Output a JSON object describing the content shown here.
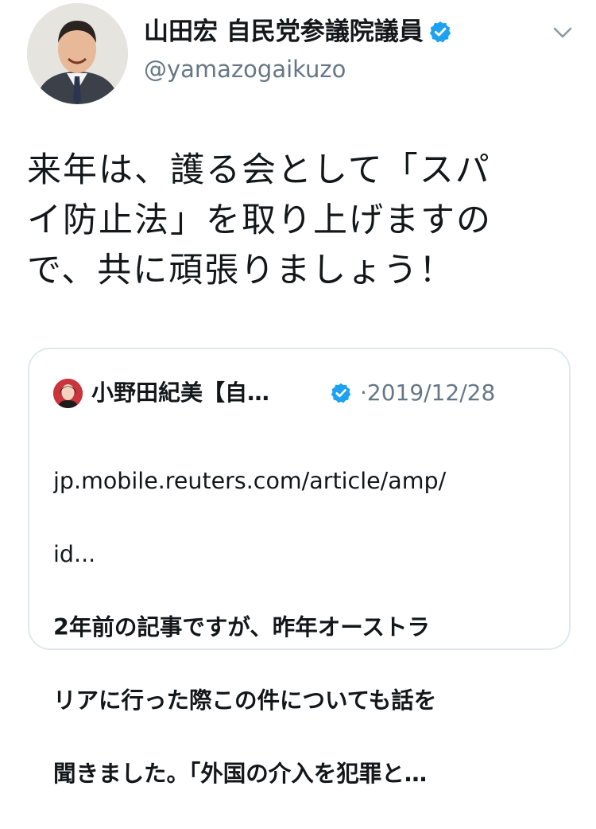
{
  "author": {
    "display_name": "山田宏 自民党参議院議員",
    "handle": "@yamazogaikuzo",
    "verified": true
  },
  "tweet": {
    "text": "来年は、護る会として「スパ\nイ防止法」を取り上げますの\nで、共に頑張りましょう！"
  },
  "quoted_tweet": {
    "author_name": "小野田紀美【自…",
    "verified": true,
    "separator": "·",
    "date": "2019/12/28",
    "link_line1": "jp.mobile.reuters.com/article/amp/",
    "link_line2": "id...",
    "body_line1": "2年前の記事ですが、昨年オーストラ",
    "body_line2": "リアに行った際この件についても話を",
    "body_line3": "聞きました。「外国の介入を犯罪と…"
  },
  "colors": {
    "verified_blue": "#1da1f2",
    "secondary_text": "#657786",
    "border": "#e1e8ed"
  },
  "icons": {
    "menu": "chevron-down-icon",
    "verified": "verified-badge-icon"
  }
}
